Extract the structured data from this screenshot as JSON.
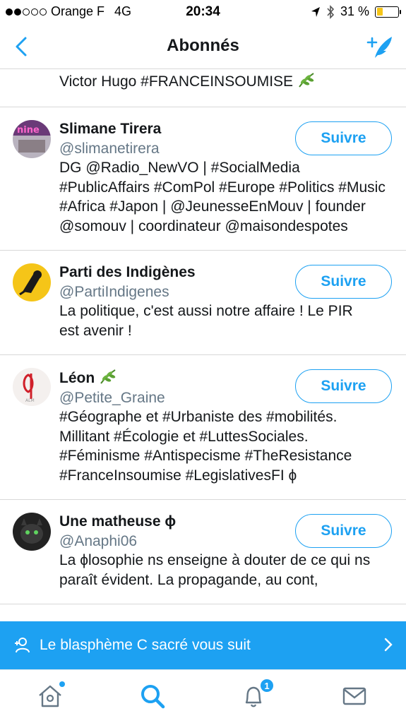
{
  "status_bar": {
    "carrier": "Orange F",
    "network": "4G",
    "time": "20:34",
    "battery_percent": "31 %",
    "battery_level": 0.31,
    "signal_bars_filled": 2,
    "signal_bars_total": 5
  },
  "nav": {
    "title": "Abonnés",
    "back_icon": "chevron-left-icon",
    "compose_icon": "compose-tweet-icon"
  },
  "partial_row": {
    "bio_text": "Victor Hugo #FRANCEINSOUMISE"
  },
  "followers": [
    {
      "name": "Slimane Tirera",
      "handle": "@slimanetirera",
      "bio": "DG @Radio_NewVO | #SocialMedia #PublicAffairs #ComPol #Europe #Politics #Music #Africa #Japon | @JeunesseEnMouv | founder @somouv | coordinateur @maisondespotes",
      "button": "Suivre",
      "avatar_color": "#7a4a8c"
    },
    {
      "name": "Parti des Indigènes",
      "handle": "@PartiIndigenes",
      "bio": "La politique, c'est aussi notre affaire ! Le PIR est avenir !",
      "button": "Suivre",
      "avatar_color": "#f5c518"
    },
    {
      "name": "Léon",
      "handle": "@Petite_Graine",
      "bio": "#Géographe et #Urbaniste des #mobilités. Millitant #Écologie et #LuttesSociales. #Féminisme #Antispecisme #TheResistance #FranceInsoumise #LegislativesFI ϕ",
      "button": "Suivre",
      "avatar_color": "#d0202a"
    },
    {
      "name": "Une matheuse ϕ",
      "handle": "@Anaphi06",
      "bio": "La ϕlosophie ns enseigne à douter de ce qui ns paraît évident. La propagande, au cont,",
      "button": "Suivre",
      "avatar_color": "#2a2a2a"
    }
  ],
  "toast": {
    "text": "Le blasphème C sacré vous suit",
    "icon": "add-user-icon"
  },
  "tab_bar": {
    "home_icon": "home-icon",
    "search_icon": "search-icon",
    "notifications_icon": "bell-icon",
    "notifications_count": "1",
    "messages_icon": "mail-icon"
  },
  "colors": {
    "accent": "#1da1f2",
    "text": "#14171a",
    "secondary_text": "#657786",
    "battery": "#f5c518"
  }
}
